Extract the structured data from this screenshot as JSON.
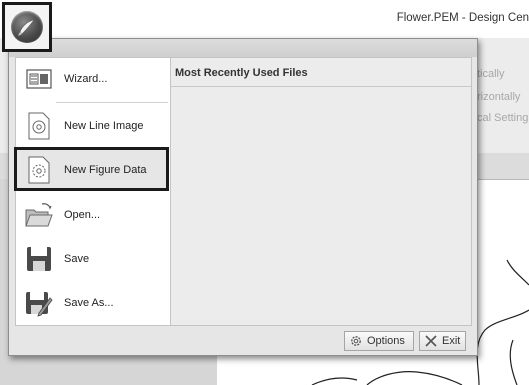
{
  "window": {
    "title": "Flower.PEM - Design Cen"
  },
  "ribbon": {
    "partial_items": [
      "tically",
      "rizontally",
      "cal Setting"
    ]
  },
  "app_menu": {
    "items": [
      {
        "label": "Wizard...",
        "icon": "wizard-icon"
      },
      {
        "label": "New Line Image",
        "icon": "new-line-image-icon"
      },
      {
        "label": "New Figure Data",
        "icon": "new-figure-data-icon"
      },
      {
        "label": "Open...",
        "icon": "folder-open-icon"
      },
      {
        "label": "Save",
        "icon": "save-icon"
      },
      {
        "label": "Save As...",
        "icon": "save-as-icon"
      }
    ],
    "highlighted_item": "New Figure Data",
    "recent_files": {
      "title": "Most Recently Used Files",
      "files": []
    },
    "footer": {
      "options_label": "Options",
      "exit_label": "Exit"
    }
  }
}
